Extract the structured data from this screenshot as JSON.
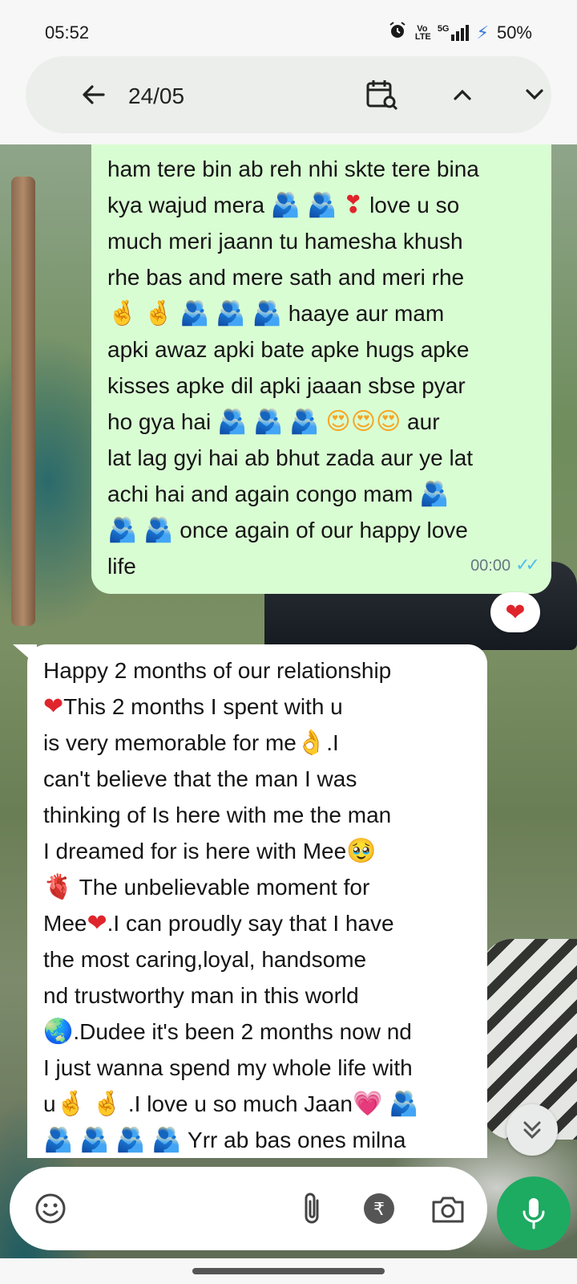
{
  "status_bar": {
    "time": "05:52",
    "network_label": "5G",
    "volte_label": "Vo LTE",
    "battery": "50%",
    "accent_color": "#3a78e0"
  },
  "header": {
    "date": "24/05",
    "icons": [
      "back-arrow-icon",
      "calendar-search-icon",
      "chevron-up-icon",
      "chevron-down-icon"
    ]
  },
  "sent_message": {
    "lines": [
      "ham tere bin ab reh nhi skte tere bina",
      "kya wajud mera 🫂🫂❣ love u so",
      "much meri jaann tu hamesha khush",
      "rhe bas and mere sath and meri rhe",
      "🤞🤞🫂🫂🫂 haaye aur mam",
      "apki awaz apki bate apke hugs apke",
      "kisses apke dil apki jaaan sbse pyar",
      "ho gya hai 🫂🫂🫂😍😍😍 aur",
      "lat lag gyi hai ab bhut zada aur ye lat",
      "achi hai and again congo mam 🫂",
      "🫂🫂 once again of our happy love",
      "life"
    ],
    "time": "00:00",
    "ticks": "✓✓",
    "reaction": "❤"
  },
  "received_message": {
    "lines": [
      "Happy 2 months of our relationship",
      "❤This 2 months I spent with u",
      "is very memorable for me👌.I",
      "can't believe that the man I was",
      "thinking of Is here with me the man",
      "I dreamed for is here with Mee🥹",
      "🫀 The unbelievable moment for",
      "Mee❤‍🩹.I can proudly say that I have",
      "the most caring,loyal, handsome",
      "nd trustworthy man in this world",
      "🌏.Dudee it's been 2 months now nd",
      "I just wanna spend my whole life with",
      "u🤞🤞.I love u so much Jaan💗🫂",
      "🫂🫂🫂🫂 Yrr ab bas ones milna"
    ]
  },
  "composer": {
    "icons": [
      "emoji-icon",
      "attach-icon",
      "rupee-icon",
      "camera-icon",
      "mic-icon"
    ],
    "mic_color": "#1daa61"
  },
  "colors": {
    "sent_bubble": "#d9fdd3",
    "received_bubble": "#ffffff",
    "read_ticks": "#53bdeb"
  }
}
